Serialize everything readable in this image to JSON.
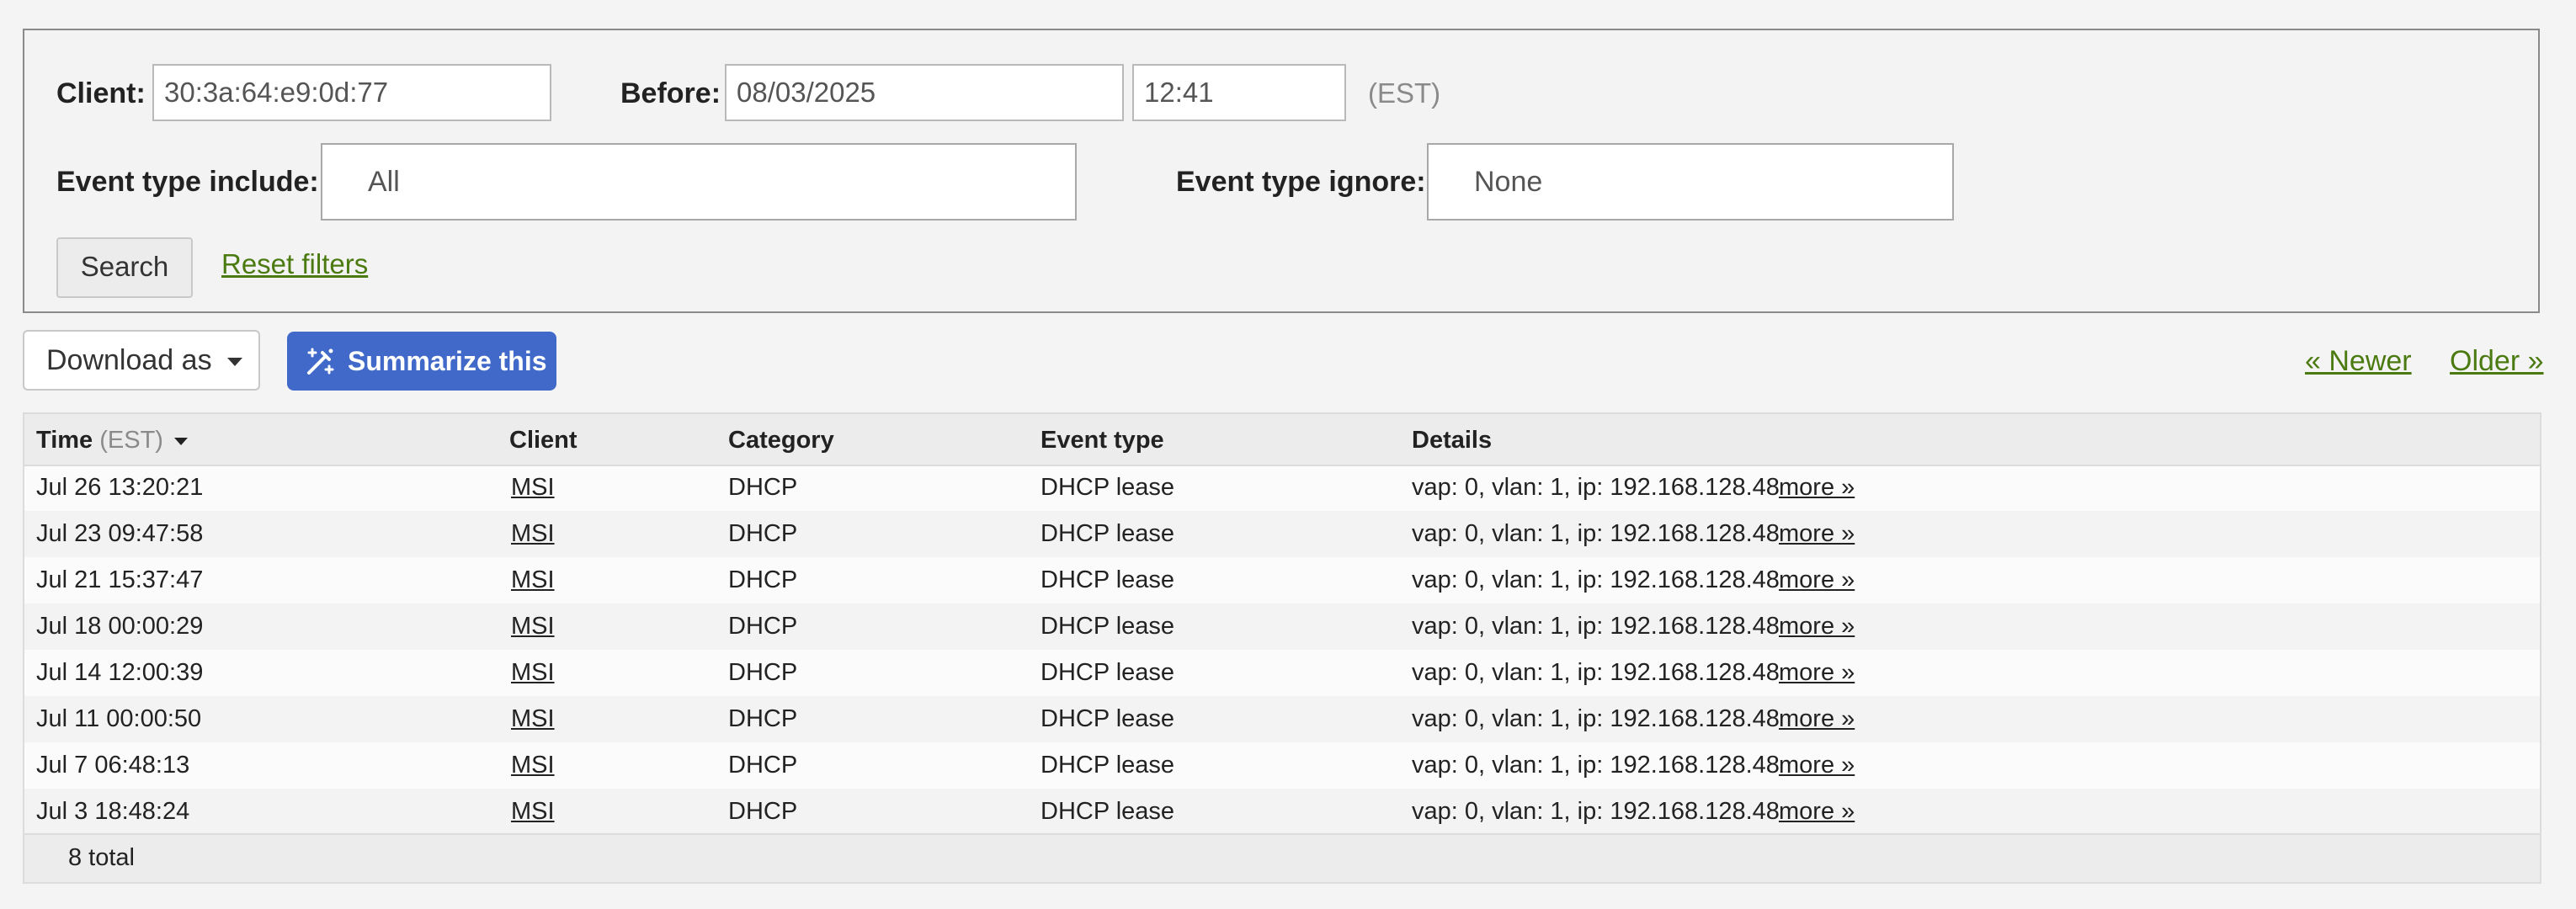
{
  "filters": {
    "client_label": "Client:",
    "client_value": "30:3a:64:e9:0d:77",
    "before_label": "Before:",
    "date_value": "08/03/2025",
    "time_value": "12:41",
    "timezone": "(EST)",
    "include_label": "Event type include:",
    "include_value": "All",
    "ignore_label": "Event type ignore:",
    "ignore_value": "None",
    "search_label": "Search",
    "reset_label": "Reset filters"
  },
  "toolbar": {
    "download_label": "Download as",
    "summarize_label": "Summarize this",
    "newer_label": "« Newer",
    "older_label": "Older »"
  },
  "table": {
    "headers": {
      "time": "Time",
      "time_tz": "(EST)",
      "client": "Client",
      "category": "Category",
      "event_type": "Event type",
      "details": "Details"
    },
    "more_label": "more »",
    "rows": [
      {
        "time": "Jul 26 13:20:21",
        "client": "MSI",
        "category": "DHCP",
        "event_type": "DHCP lease",
        "details": "vap: 0, vlan: 1, ip: 192.168.128.48"
      },
      {
        "time": "Jul 23 09:47:58",
        "client": "MSI",
        "category": "DHCP",
        "event_type": "DHCP lease",
        "details": "vap: 0, vlan: 1, ip: 192.168.128.48"
      },
      {
        "time": "Jul 21 15:37:47",
        "client": "MSI",
        "category": "DHCP",
        "event_type": "DHCP lease",
        "details": "vap: 0, vlan: 1, ip: 192.168.128.48"
      },
      {
        "time": "Jul 18 00:00:29",
        "client": "MSI",
        "category": "DHCP",
        "event_type": "DHCP lease",
        "details": "vap: 0, vlan: 1, ip: 192.168.128.48"
      },
      {
        "time": "Jul 14 12:00:39",
        "client": "MSI",
        "category": "DHCP",
        "event_type": "DHCP lease",
        "details": "vap: 0, vlan: 1, ip: 192.168.128.48"
      },
      {
        "time": "Jul 11 00:00:50",
        "client": "MSI",
        "category": "DHCP",
        "event_type": "DHCP lease",
        "details": "vap: 0, vlan: 1, ip: 192.168.128.48"
      },
      {
        "time": "Jul 7 06:48:13",
        "client": "MSI",
        "category": "DHCP",
        "event_type": "DHCP lease",
        "details": "vap: 0, vlan: 1, ip: 192.168.128.48"
      },
      {
        "time": "Jul 3 18:48:24",
        "client": "MSI",
        "category": "DHCP",
        "event_type": "DHCP lease",
        "details": "vap: 0, vlan: 1, ip: 192.168.128.48"
      }
    ],
    "total_label": "8 total"
  },
  "colors": {
    "link": "#4a7a10",
    "summarize_bg": "#4169c9"
  },
  "icons": {
    "summarize": "magic-wand-icon",
    "download_caret": "caret-down-icon",
    "sort": "sort-desc-icon"
  }
}
